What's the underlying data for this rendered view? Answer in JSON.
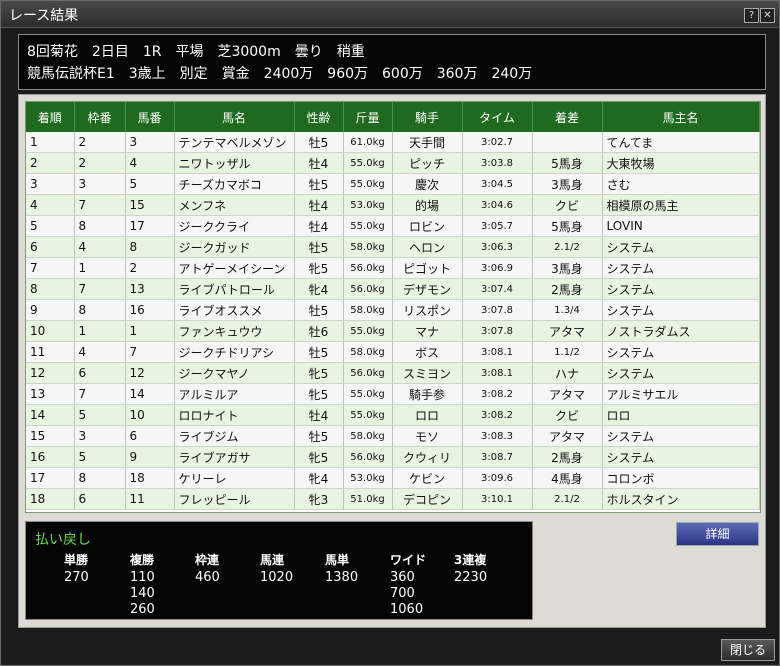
{
  "window": {
    "title": "レース結果",
    "help_label": "?",
    "close_label": "✕"
  },
  "race_header": {
    "line1": "8回菊花　2日目　1R　平場　芝3000m　曇り　稍重",
    "line2": "競馬伝説杯E1　3歳上　別定　賞金　2400万　960万　600万　360万　240万"
  },
  "results": {
    "headers": [
      "着順",
      "枠番",
      "馬番",
      "馬名",
      "性齢",
      "斤量",
      "騎手",
      "タイム",
      "着差",
      "馬主名"
    ],
    "rows": [
      [
        "1",
        "2",
        "3",
        "テンテマベルメゾン",
        "牡5",
        "61.0kg",
        "天手間",
        "3:02.7",
        "",
        "てんてま"
      ],
      [
        "2",
        "2",
        "4",
        "ニワトッザル",
        "牡4",
        "55.0kg",
        "ピッチ",
        "3:03.8",
        "5馬身",
        "大東牧場"
      ],
      [
        "3",
        "3",
        "5",
        "チーズカマボコ",
        "牡5",
        "55.0kg",
        "慶次",
        "3:04.5",
        "3馬身",
        "さむ"
      ],
      [
        "4",
        "7",
        "15",
        "メンフネ",
        "牡4",
        "53.0kg",
        "的場",
        "3:04.6",
        "クビ",
        "相模原の馬主"
      ],
      [
        "5",
        "8",
        "17",
        "ジーククライ",
        "牡4",
        "55.0kg",
        "ロビン",
        "3:05.7",
        "5馬身",
        "LOVIN"
      ],
      [
        "6",
        "4",
        "8",
        "ジークガッド",
        "牡5",
        "58.0kg",
        "ヘロン",
        "3:06.3",
        "2.1/2",
        "システム"
      ],
      [
        "7",
        "1",
        "2",
        "アトゲーメイシーン",
        "牝5",
        "56.0kg",
        "ピゴット",
        "3:06.9",
        "3馬身",
        "システム"
      ],
      [
        "8",
        "7",
        "13",
        "ライブパトロール",
        "牝4",
        "56.0kg",
        "デザモン",
        "3:07.4",
        "2馬身",
        "システム"
      ],
      [
        "9",
        "8",
        "16",
        "ライブオススメ",
        "牡5",
        "58.0kg",
        "リスポン",
        "3:07.8",
        "1.3/4",
        "システム"
      ],
      [
        "10",
        "1",
        "1",
        "ファンキュウウ",
        "牡6",
        "55.0kg",
        "マナ",
        "3:07.8",
        "アタマ",
        "ノストラダムス"
      ],
      [
        "11",
        "4",
        "7",
        "ジークチドリアシ",
        "牡5",
        "58.0kg",
        "ボス",
        "3:08.1",
        "1.1/2",
        "システム"
      ],
      [
        "12",
        "6",
        "12",
        "ジークマヤノ",
        "牝5",
        "56.0kg",
        "スミヨン",
        "3:08.1",
        "ハナ",
        "システム"
      ],
      [
        "13",
        "7",
        "14",
        "アルミルア",
        "牝5",
        "55.0kg",
        "騎手参",
        "3:08.2",
        "アタマ",
        "アルミサエル"
      ],
      [
        "14",
        "5",
        "10",
        "ロロナイト",
        "牡4",
        "55.0kg",
        "ロロ",
        "3:08.2",
        "クビ",
        "ロロ"
      ],
      [
        "15",
        "3",
        "6",
        "ライブジム",
        "牡5",
        "58.0kg",
        "モソ",
        "3:08.3",
        "アタマ",
        "システム"
      ],
      [
        "16",
        "5",
        "9",
        "ライブアガサ",
        "牝5",
        "56.0kg",
        "クウィリ",
        "3:08.7",
        "2馬身",
        "システム"
      ],
      [
        "17",
        "8",
        "18",
        "ケリーレ",
        "牝4",
        "53.0kg",
        "ケビン",
        "3:09.6",
        "4馬身",
        "コロンボ"
      ],
      [
        "18",
        "6",
        "11",
        "フレッピール",
        "牝3",
        "51.0kg",
        "デコピン",
        "3:10.1",
        "2.1/2",
        "ホルスタイン"
      ]
    ]
  },
  "payout": {
    "title": "払い戻し",
    "columns": [
      {
        "label": "単勝",
        "values": [
          "270"
        ]
      },
      {
        "label": "複勝",
        "values": [
          "110",
          "140",
          "260"
        ]
      },
      {
        "label": "枠連",
        "values": [
          "460"
        ]
      },
      {
        "label": "馬連",
        "values": [
          "1020"
        ]
      },
      {
        "label": "馬単",
        "values": [
          "1380"
        ]
      },
      {
        "label": "ワイド",
        "values": [
          "360",
          "700",
          "1060"
        ]
      },
      {
        "label": "3連複",
        "values": [
          "2230"
        ]
      }
    ]
  },
  "buttons": {
    "detail_label": "詳細",
    "close_label": "閉じる"
  }
}
